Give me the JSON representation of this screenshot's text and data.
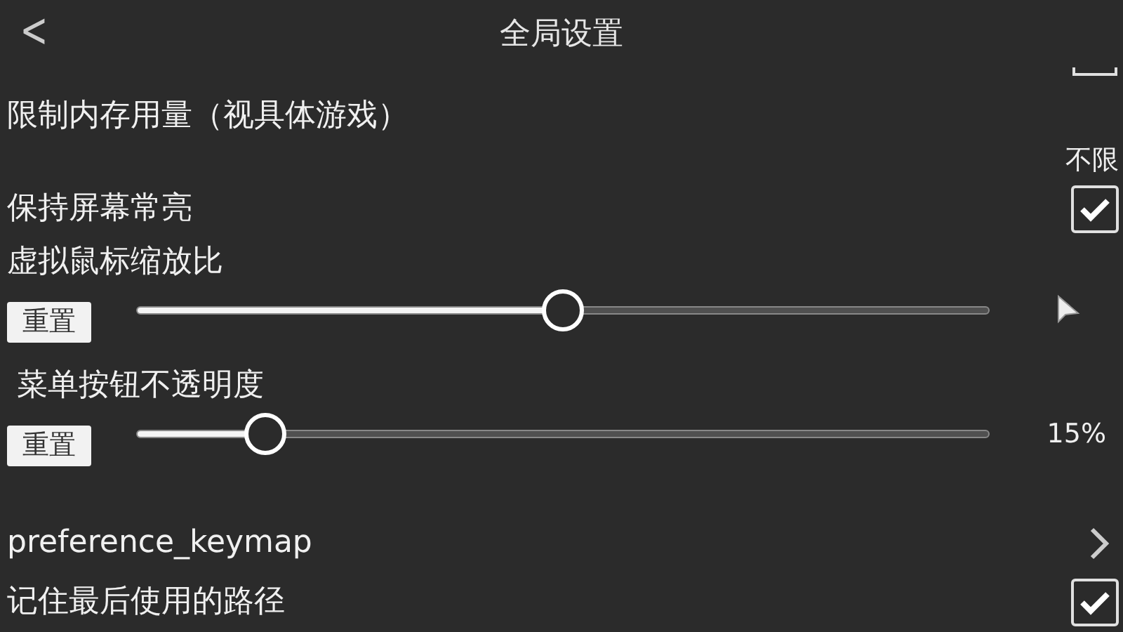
{
  "header": {
    "back": "<",
    "title": "全局设置"
  },
  "items": [
    {
      "kind": "select",
      "label": "限制内存用量（视具体游戏）",
      "value": "不限"
    },
    {
      "kind": "checkbox",
      "label": "保持屏幕常亮",
      "checked": true
    },
    {
      "kind": "slider",
      "label": "虚拟鼠标缩放比",
      "reset": "重置",
      "level": 0.5,
      "reading": {
        "kind": "cursor"
      }
    },
    {
      "kind": "slider",
      "label": " 菜单按钮不透明度",
      "reset": "重置",
      "level": 0.15,
      "reading": {
        "kind": "text",
        "text": "15%"
      }
    },
    {
      "kind": "link",
      "label": "preference_keymap"
    },
    {
      "kind": "checkbox",
      "label": "记住最后使用的路径",
      "checked": true
    }
  ]
}
